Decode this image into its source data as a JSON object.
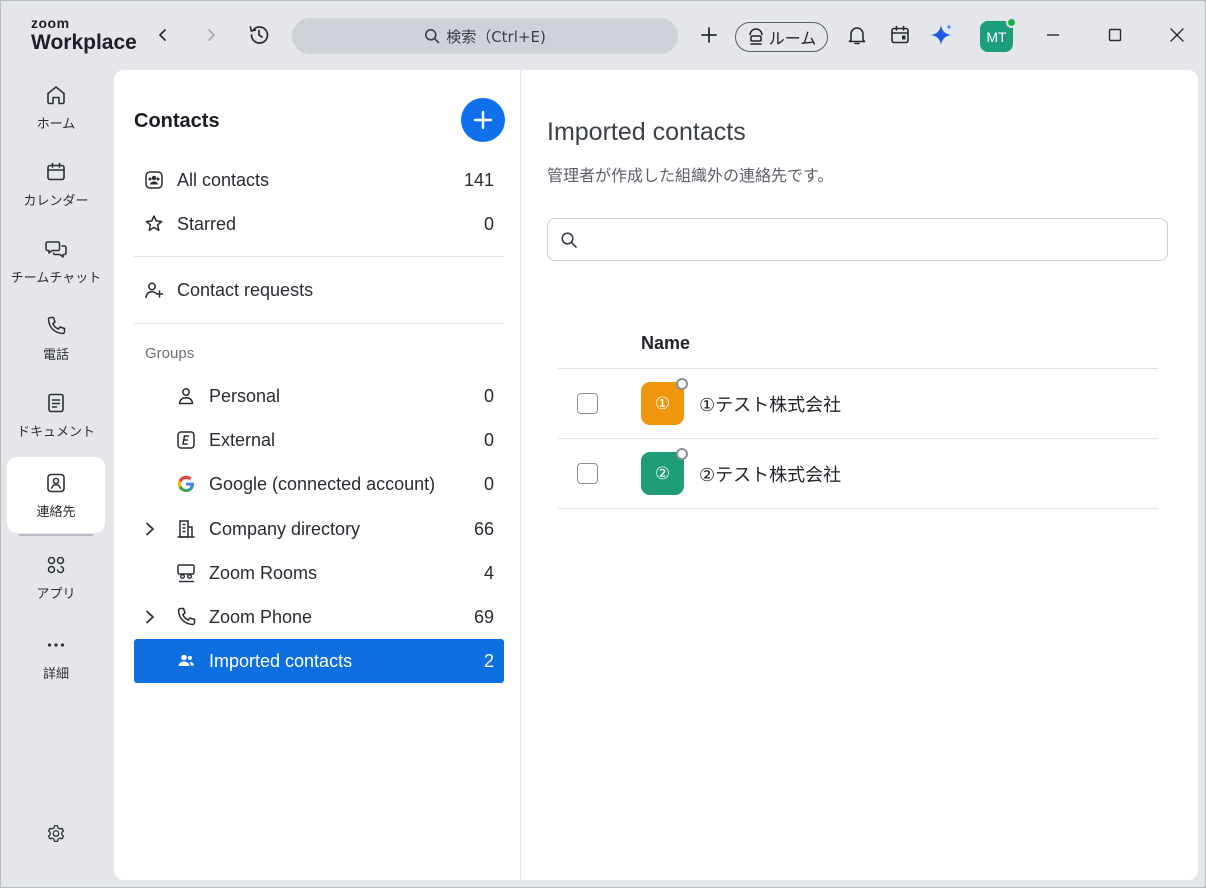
{
  "app": {
    "logo_top": "zoom",
    "logo_bottom": "Workplace",
    "search_label": "検索（Ctrl+E)",
    "room_label": "ルーム",
    "avatar_initials": "MT"
  },
  "rail": {
    "items": [
      {
        "label": "ホーム",
        "icon": "home-icon"
      },
      {
        "label": "カレンダー",
        "icon": "calendar-icon"
      },
      {
        "label": "チームチャット",
        "icon": "chat-icon"
      },
      {
        "label": "電話",
        "icon": "phone-icon"
      },
      {
        "label": "ドキュメント",
        "icon": "document-icon"
      },
      {
        "label": "連絡先",
        "icon": "contacts-icon",
        "active": true
      },
      {
        "label": "アプリ",
        "icon": "apps-icon"
      },
      {
        "label": "詳細",
        "icon": "more-icon"
      }
    ]
  },
  "contacts": {
    "title": "Contacts",
    "all_contacts": {
      "label": "All contacts",
      "count": "141"
    },
    "starred": {
      "label": "Starred",
      "count": "0"
    },
    "requests": {
      "label": "Contact requests"
    },
    "groups_label": "Groups",
    "groups": [
      {
        "label": "Personal",
        "count": "0",
        "icon": "person-icon"
      },
      {
        "label": "External",
        "count": "0",
        "icon": "external-icon"
      },
      {
        "label": "Google (connected account)",
        "count": "0",
        "icon": "google-icon"
      },
      {
        "label": "Company directory",
        "count": "66",
        "icon": "building-icon",
        "expandable": true
      },
      {
        "label": "Zoom Rooms",
        "count": "4",
        "icon": "zoom-rooms-icon"
      },
      {
        "label": "Zoom Phone",
        "count": "69",
        "icon": "phone-icon",
        "expandable": true
      },
      {
        "label": "Imported contacts",
        "count": "2",
        "icon": "people-icon",
        "selected": true
      }
    ]
  },
  "imported": {
    "title": "Imported contacts",
    "subtitle": "管理者が作成した組織外の連絡先です。",
    "search_placeholder": "",
    "column_name": "Name",
    "rows": [
      {
        "avatar": "①",
        "name": "①テスト株式会社",
        "color": "#f0960c"
      },
      {
        "avatar": "②",
        "name": "②テスト株式会社",
        "color": "#1f9c78"
      }
    ]
  },
  "colors": {
    "accent": "#0e71eb",
    "selected_bg": "#0e6fe0",
    "avatar_mt": "#1a9e7c"
  }
}
